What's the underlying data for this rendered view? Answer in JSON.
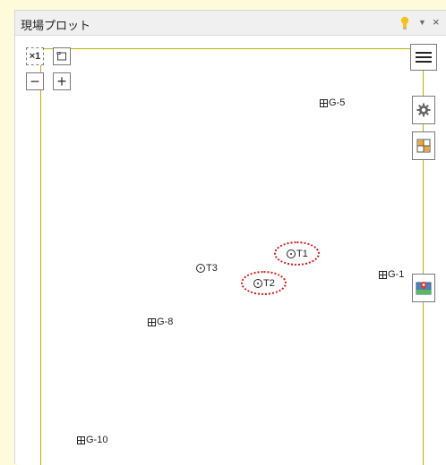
{
  "window": {
    "title": "現場プロット",
    "dropdown_glyph": "▼",
    "close_glyph": "×"
  },
  "toolbar": {
    "zoom_reset_label": "×1",
    "zoom_out_label": "−",
    "zoom_in_label": "+"
  },
  "side_tools": {
    "menu_icon": "menu-icon",
    "settings_icon": "gear-icon",
    "layer_icon": "layers-icon",
    "map_icon": "map-pin-icon"
  },
  "markers": {
    "g5": "G-5",
    "g1": "G-1",
    "g8": "G-8",
    "g10": "G-10",
    "t1": "T1",
    "t2": "T2",
    "t3": "T3"
  },
  "colors": {
    "accent_line": "#b5b500",
    "highlight": "#d51a1a",
    "panel_bg": "#fdfbd9"
  }
}
